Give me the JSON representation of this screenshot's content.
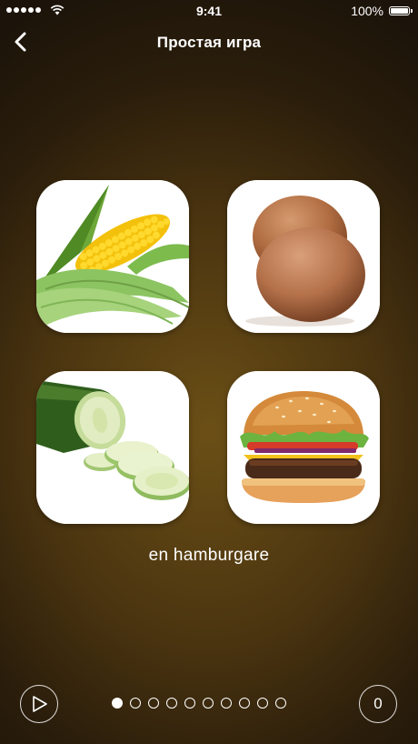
{
  "status": {
    "time": "9:41",
    "battery": "100%"
  },
  "nav": {
    "title": "Простая игра"
  },
  "cards": [
    {
      "name": "corn"
    },
    {
      "name": "eggs"
    },
    {
      "name": "cucumber"
    },
    {
      "name": "hamburger"
    }
  ],
  "prompt": {
    "word": "en hamburgare"
  },
  "progress": {
    "total": 10,
    "current": 1
  },
  "score": {
    "value": "0"
  }
}
